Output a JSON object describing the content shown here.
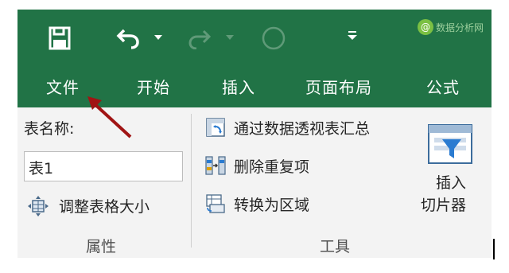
{
  "tabs": [
    "文件",
    "开始",
    "插入",
    "页面布局",
    "公式"
  ],
  "properties": {
    "table_name_label": "表名称:",
    "table_name_value": "表1",
    "resize_label": "调整表格大小",
    "group_label": "属性"
  },
  "tools": {
    "pivot_label": "通过数据透视表汇总",
    "dedupe_label": "删除重复项",
    "convert_label": "转换为区域",
    "group_label": "工具"
  },
  "slicer": {
    "line1": "插入",
    "line2": "切片器"
  },
  "watermark": "数据分析网",
  "icons": [
    "save-icon",
    "undo-icon",
    "dropdown-arrow-icon",
    "redo-icon",
    "touch-mode-icon",
    "customize-qat-icon",
    "pivot-table-icon",
    "remove-duplicates-icon",
    "convert-range-icon",
    "resize-table-icon",
    "slicer-icon",
    "annotation-arrow",
    "watermark-logo-icon"
  ],
  "colors": {
    "ribbon_green": "#217346",
    "annotation_red": "#a01414"
  }
}
